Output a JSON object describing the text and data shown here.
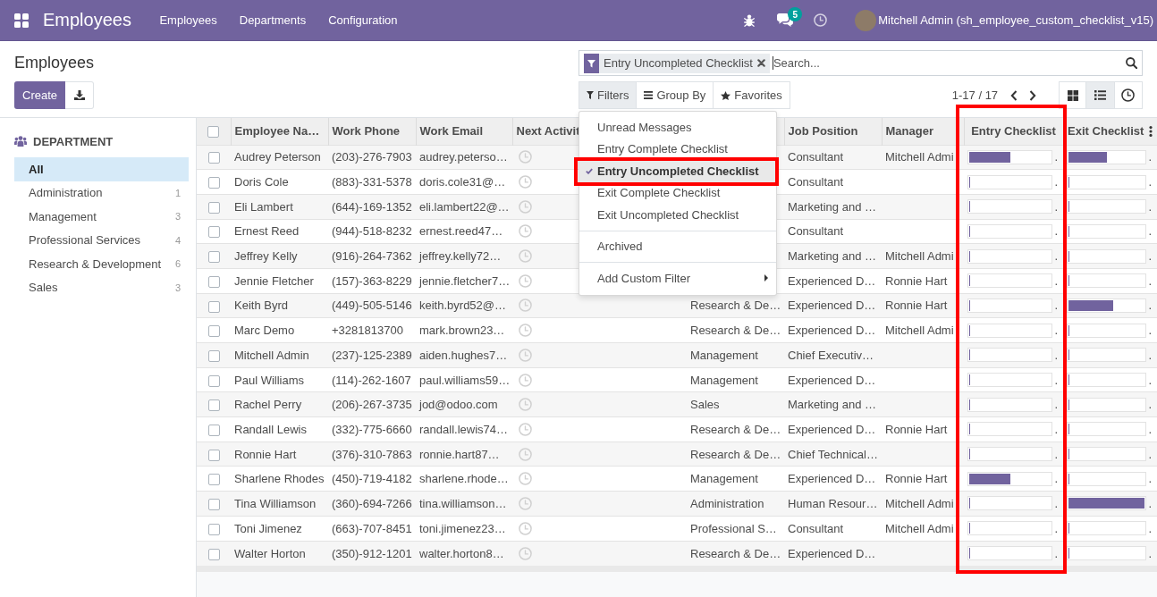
{
  "navbar": {
    "app_name": "Employees",
    "menus": [
      "Employees",
      "Departments",
      "Configuration"
    ],
    "message_count": "5",
    "user_name": "Mitchell Admin (sh_employee_custom_checklist_v15)"
  },
  "control_panel": {
    "title": "Employees",
    "create_button": "Create",
    "search": {
      "facets": [
        {
          "label": "Entry Uncompleted Checklist"
        }
      ],
      "placeholder": "Search..."
    },
    "filters": {
      "label": "Filters",
      "expanded": true,
      "menu": {
        "groups": [
          {
            "items": [
              {
                "label": "Unread Messages",
                "checked": false,
                "highlighted": false
              },
              {
                "label": "Entry Complete Checklist",
                "checked": false,
                "highlighted": false
              },
              {
                "label": "Entry Uncompleted Checklist",
                "checked": true,
                "highlighted": true
              },
              {
                "label": "Exit Complete Checklist",
                "checked": false,
                "highlighted": false
              },
              {
                "label": "Exit Uncompleted Checklist",
                "checked": false,
                "highlighted": false
              }
            ]
          },
          {
            "items": [
              {
                "label": "Archived",
                "checked": false,
                "highlighted": false
              }
            ]
          }
        ],
        "custom_filter": "Add Custom Filter"
      }
    },
    "group_by": "Group By",
    "favorites": "Favorites",
    "pager": "1-17 / 17",
    "views": [
      {
        "kind": "kanban",
        "selected": false
      },
      {
        "kind": "list",
        "selected": true
      },
      {
        "kind": "activity",
        "selected": false
      }
    ]
  },
  "sidebar": {
    "title": "DEPARTMENT",
    "items": [
      {
        "label": "All",
        "selected": true
      },
      {
        "label": "Administration",
        "count": "1",
        "selected": false
      },
      {
        "label": "Management",
        "count": "3",
        "selected": false
      },
      {
        "label": "Professional Services",
        "count": "4",
        "selected": false
      },
      {
        "label": "Research & Development",
        "count": "6",
        "selected": false
      },
      {
        "label": "Sales",
        "count": "3",
        "selected": false
      }
    ]
  },
  "table": {
    "select_all_checked": false,
    "columns": [
      {
        "label": "Employee Na…",
        "kind": "text",
        "highlighted": false
      },
      {
        "label": "Work Phone",
        "kind": "text",
        "highlighted": false
      },
      {
        "label": "Work Email",
        "kind": "text",
        "highlighted": false
      },
      {
        "label": "Next Activit",
        "kind": "activity",
        "highlighted": false
      },
      {
        "kind": "text",
        "highlighted": false
      },
      {
        "label": "Job Position",
        "kind": "text",
        "highlighted": false
      },
      {
        "label": "Manager",
        "kind": "text",
        "highlighted": false
      },
      {
        "label": "Entry Checklist",
        "kind": "progress",
        "highlighted": true
      },
      {
        "label": "Exit Checklist",
        "kind": "progress",
        "highlighted": false
      }
    ],
    "rows": [
      {
        "checked": false,
        "employee_name": "Audrey Peterson",
        "work_phone": "(203)-276-7903",
        "work_email": "audrey.peterso…",
        "job_position": "Consultant",
        "manager": "Mitchell Admi",
        "entry_checklist": {
          "level": 0.5,
          "reading": "."
        },
        "exit_checklist": {
          "level": 0.5,
          "reading": "."
        }
      },
      {
        "checked": false,
        "employee_name": "Doris Cole",
        "work_phone": "(883)-331-5378",
        "work_email": "doris.cole31@…",
        "job_position": "Consultant",
        "entry_checklist": {
          "level": 0,
          "reading": "."
        },
        "exit_checklist": {
          "level": 0,
          "reading": "."
        }
      },
      {
        "checked": false,
        "employee_name": "Eli Lambert",
        "work_phone": "(644)-169-1352",
        "work_email": "eli.lambert22@…",
        "job_position": "Marketing and …",
        "entry_checklist": {
          "level": 0,
          "reading": "."
        },
        "exit_checklist": {
          "level": 0,
          "reading": "."
        }
      },
      {
        "checked": false,
        "employee_name": "Ernest Reed",
        "work_phone": "(944)-518-8232",
        "work_email": "ernest.reed47…",
        "job_position": "Consultant",
        "entry_checklist": {
          "level": 0,
          "reading": "."
        },
        "exit_checklist": {
          "level": 0,
          "reading": "."
        }
      },
      {
        "checked": false,
        "employee_name": "Jeffrey Kelly",
        "work_phone": "(916)-264-7362",
        "work_email": "jeffrey.kelly72…",
        "job_position": "Marketing and …",
        "manager": "Mitchell Admi",
        "entry_checklist": {
          "level": 0,
          "reading": "."
        },
        "exit_checklist": {
          "level": 0,
          "reading": "."
        }
      },
      {
        "checked": false,
        "employee_name": "Jennie Fletcher",
        "work_phone": "(157)-363-8229",
        "work_email": "jennie.fletcher7…",
        "job_position": "Experienced D…",
        "manager": "Ronnie Hart",
        "entry_checklist": {
          "level": 0,
          "reading": "."
        },
        "exit_checklist": {
          "level": 0,
          "reading": "."
        }
      },
      {
        "checked": false,
        "employee_name": "Keith Byrd",
        "work_phone": "(449)-505-5146",
        "work_email": "keith.byrd52@…",
        "column_5": "Research & De…",
        "job_position": "Experienced D…",
        "manager": "Ronnie Hart",
        "entry_checklist": {
          "level": 0,
          "reading": "."
        },
        "exit_checklist": {
          "level": 0.58,
          "reading": "."
        }
      },
      {
        "checked": false,
        "employee_name": "Marc Demo",
        "work_phone": "+3281813700",
        "work_email": "mark.brown23…",
        "column_5": "Research & De…",
        "job_position": "Experienced D…",
        "manager": "Mitchell Admi",
        "entry_checklist": {
          "level": 0,
          "reading": "."
        },
        "exit_checklist": {
          "level": 0,
          "reading": "."
        }
      },
      {
        "checked": false,
        "employee_name": "Mitchell Admin",
        "work_phone": "(237)-125-2389",
        "work_email": "aiden.hughes7…",
        "column_5": "Management",
        "job_position": "Chief Executiv…",
        "entry_checklist": {
          "level": 0,
          "reading": "."
        },
        "exit_checklist": {
          "level": 0,
          "reading": "."
        }
      },
      {
        "checked": false,
        "employee_name": "Paul Williams",
        "work_phone": "(114)-262-1607",
        "work_email": "paul.williams59…",
        "column_5": "Management",
        "job_position": "Experienced D…",
        "entry_checklist": {
          "level": 0,
          "reading": "."
        },
        "exit_checklist": {
          "level": 0,
          "reading": "."
        }
      },
      {
        "checked": false,
        "employee_name": "Rachel Perry",
        "work_phone": "(206)-267-3735",
        "work_email": "jod@odoo.com",
        "column_5": "Sales",
        "job_position": "Marketing and …",
        "entry_checklist": {
          "level": 0,
          "reading": "."
        },
        "exit_checklist": {
          "level": 0,
          "reading": "."
        }
      },
      {
        "checked": false,
        "employee_name": "Randall Lewis",
        "work_phone": "(332)-775-6660",
        "work_email": "randall.lewis74…",
        "column_5": "Research & De…",
        "job_position": "Experienced D…",
        "manager": "Ronnie Hart",
        "entry_checklist": {
          "level": 0,
          "reading": "."
        },
        "exit_checklist": {
          "level": 0,
          "reading": "."
        }
      },
      {
        "checked": false,
        "employee_name": "Ronnie Hart",
        "work_phone": "(376)-310-7863",
        "work_email": "ronnie.hart87…",
        "column_5": "Research & De…",
        "job_position": "Chief Technical…",
        "entry_checklist": {
          "level": 0,
          "reading": "."
        },
        "exit_checklist": {
          "level": 0,
          "reading": "."
        }
      },
      {
        "checked": false,
        "employee_name": "Sharlene Rhodes",
        "work_phone": "(450)-719-4182",
        "work_email": "sharlene.rhode…",
        "column_5": "Management",
        "job_position": "Experienced D…",
        "manager": "Ronnie Hart",
        "entry_checklist": {
          "level": 0.5,
          "reading": "."
        },
        "exit_checklist": {
          "level": 0,
          "reading": "."
        }
      },
      {
        "checked": false,
        "employee_name": "Tina Williamson",
        "work_phone": "(360)-694-7266",
        "work_email": "tina.williamson…",
        "column_5": "Administration",
        "job_position": "Human Resour…",
        "manager": "Mitchell Admi",
        "entry_checklist": {
          "level": 0,
          "reading": "."
        },
        "exit_checklist": {
          "level": 1,
          "reading": "."
        }
      },
      {
        "checked": false,
        "employee_name": "Toni Jimenez",
        "work_phone": "(663)-707-8451",
        "work_email": "toni.jimenez23…",
        "column_5": "Professional S…",
        "job_position": "Consultant",
        "manager": "Mitchell Admi",
        "entry_checklist": {
          "level": 0,
          "reading": "."
        },
        "exit_checklist": {
          "level": 0,
          "reading": "."
        }
      },
      {
        "checked": false,
        "employee_name": "Walter Horton",
        "work_phone": "(350)-912-1201",
        "work_email": "walter.horton8…",
        "column_5": "Research & De…",
        "job_position": "Experienced D…",
        "entry_checklist": {
          "level": 0,
          "reading": "."
        },
        "exit_checklist": {
          "level": 0,
          "reading": "."
        }
      }
    ]
  }
}
